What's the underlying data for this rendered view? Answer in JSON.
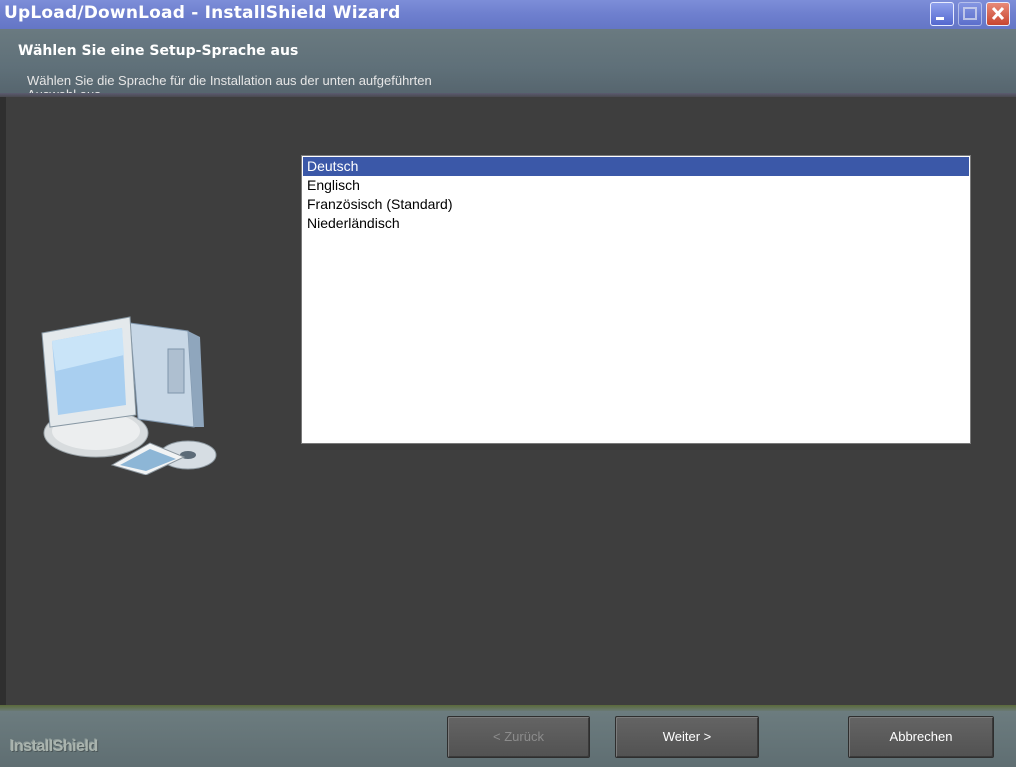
{
  "window": {
    "title": "UpLoad/DownLoad - InstallShield Wizard",
    "controls": [
      "minimize-icon",
      "maximize-icon",
      "close-icon"
    ]
  },
  "header": {
    "title": "Wählen Sie eine Setup-Sprache aus",
    "subtitle": "Wählen Sie die Sprache für die Installation aus der unten aufgeführten Auswahl aus."
  },
  "languages": {
    "items": [
      "Deutsch",
      "Englisch",
      "Französisch (Standard)",
      "Niederländisch"
    ],
    "selected": "Deutsch"
  },
  "footer": {
    "brand": "InstallShield",
    "back_label": "< Zurück",
    "next_label": "Weiter >",
    "cancel_label": "Abbrechen"
  },
  "colors": {
    "titlebar": "#6f80cf",
    "header": "#5f7079",
    "body": "#3e3e3e",
    "selection": "#3b58a8"
  }
}
